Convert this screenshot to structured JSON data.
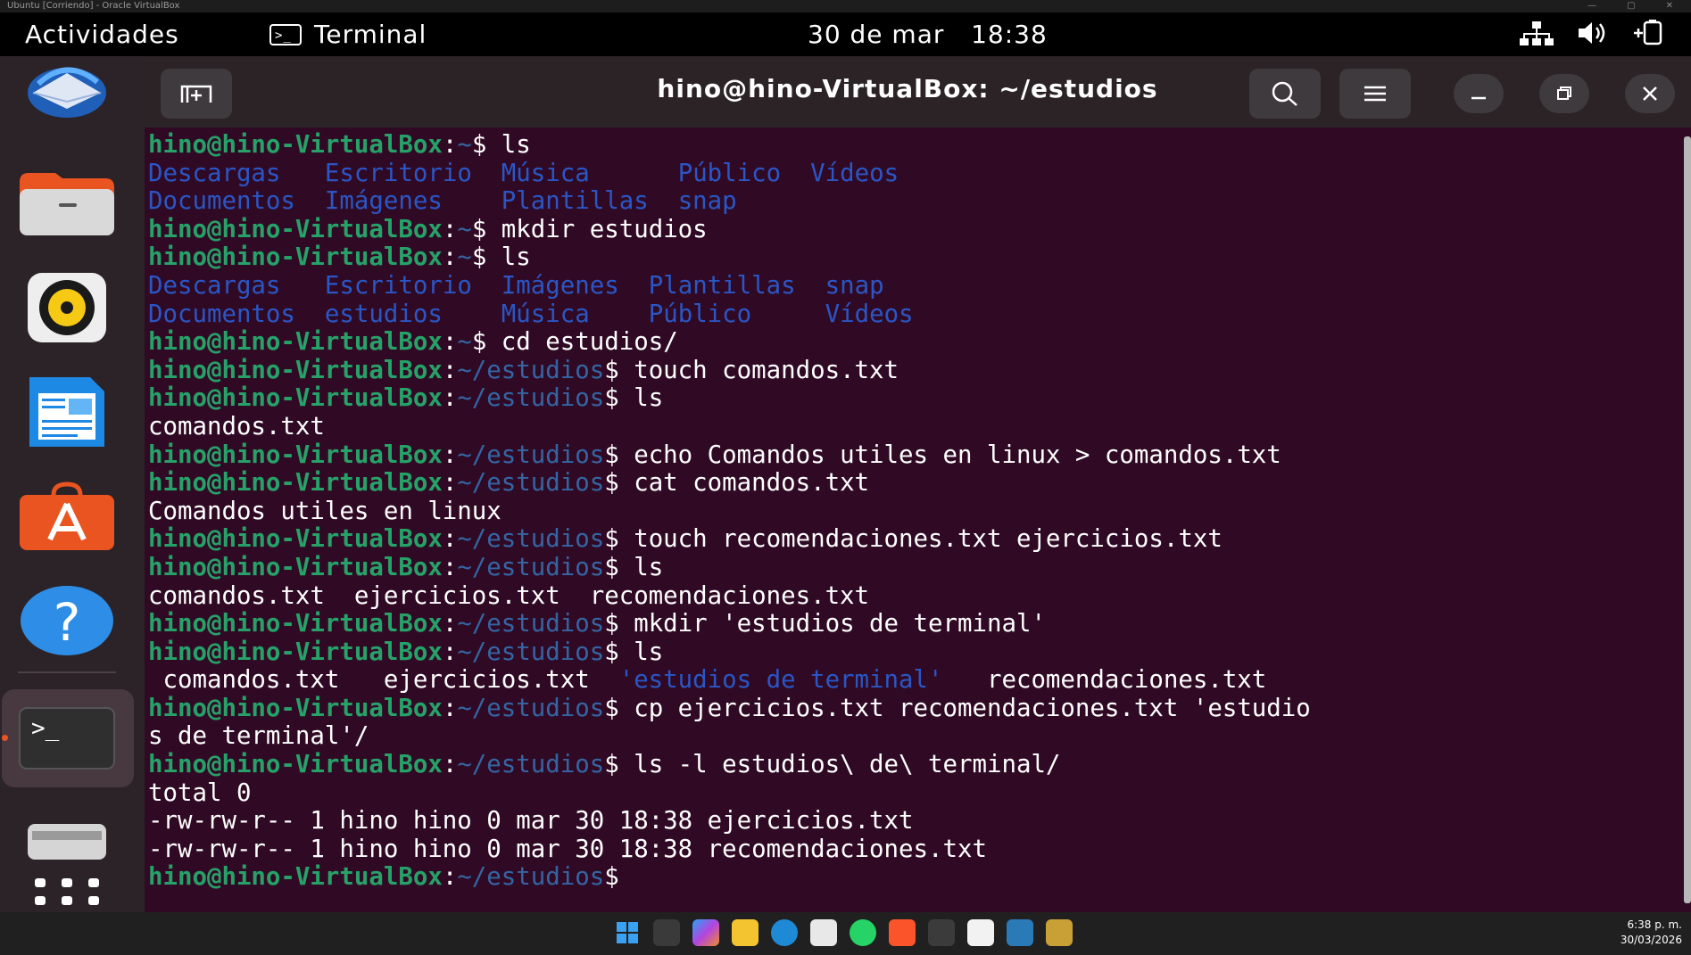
{
  "host": {
    "title": "Ubuntu [Corriendo] - Oracle VirtualBox",
    "controls": [
      "—",
      "▢",
      "✕"
    ]
  },
  "topbar": {
    "activities": "Actividades",
    "app_name": "Terminal",
    "term_glyph": ">_",
    "date": "30 de mar",
    "time": "18:38"
  },
  "window": {
    "title": "hino@hino-VirtualBox: ~/estudios"
  },
  "terminal": {
    "user": "hino@hino-VirtualBox",
    "lines": [
      [
        {
          "t": "hino@hino-VirtualBox",
          "c": "pu"
        },
        {
          "t": ":",
          "c": ""
        },
        {
          "t": "~",
          "c": "pp"
        },
        {
          "t": "$ ls",
          "c": ""
        }
      ],
      [
        {
          "t": "Descargas  ",
          "c": "dir"
        },
        {
          "t": " ",
          "c": ""
        },
        {
          "t": "Escritorio",
          "c": "dir"
        },
        {
          "t": "  ",
          "c": ""
        },
        {
          "t": "Música",
          "c": "dir"
        },
        {
          "t": "      ",
          "c": ""
        },
        {
          "t": "Público",
          "c": "dir"
        },
        {
          "t": "  ",
          "c": ""
        },
        {
          "t": "Vídeos",
          "c": "dir"
        }
      ],
      [
        {
          "t": "Documentos",
          "c": "dir"
        },
        {
          "t": "  ",
          "c": ""
        },
        {
          "t": "Imágenes",
          "c": "dir"
        },
        {
          "t": "    ",
          "c": ""
        },
        {
          "t": "Plantillas",
          "c": "dir"
        },
        {
          "t": "  ",
          "c": ""
        },
        {
          "t": "snap",
          "c": "dir"
        }
      ],
      [
        {
          "t": "hino@hino-VirtualBox",
          "c": "pu"
        },
        {
          "t": ":",
          "c": ""
        },
        {
          "t": "~",
          "c": "pp"
        },
        {
          "t": "$ mkdir estudios",
          "c": ""
        }
      ],
      [
        {
          "t": "hino@hino-VirtualBox",
          "c": "pu"
        },
        {
          "t": ":",
          "c": ""
        },
        {
          "t": "~",
          "c": "pp"
        },
        {
          "t": "$ ls",
          "c": ""
        }
      ],
      [
        {
          "t": "Descargas",
          "c": "dir"
        },
        {
          "t": "   ",
          "c": ""
        },
        {
          "t": "Escritorio",
          "c": "dir"
        },
        {
          "t": "  ",
          "c": ""
        },
        {
          "t": "Imágenes",
          "c": "dir"
        },
        {
          "t": "  ",
          "c": ""
        },
        {
          "t": "Plantillas",
          "c": "dir"
        },
        {
          "t": "  ",
          "c": ""
        },
        {
          "t": "snap",
          "c": "dir"
        }
      ],
      [
        {
          "t": "Documentos",
          "c": "dir"
        },
        {
          "t": "  ",
          "c": ""
        },
        {
          "t": "estudios",
          "c": "dir"
        },
        {
          "t": "    ",
          "c": ""
        },
        {
          "t": "Música",
          "c": "dir"
        },
        {
          "t": "    ",
          "c": ""
        },
        {
          "t": "Público",
          "c": "dir"
        },
        {
          "t": "     ",
          "c": ""
        },
        {
          "t": "Vídeos",
          "c": "dir"
        }
      ],
      [
        {
          "t": "hino@hino-VirtualBox",
          "c": "pu"
        },
        {
          "t": ":",
          "c": ""
        },
        {
          "t": "~",
          "c": "pp"
        },
        {
          "t": "$ cd estudios/",
          "c": ""
        }
      ],
      [
        {
          "t": "hino@hino-VirtualBox",
          "c": "pu"
        },
        {
          "t": ":",
          "c": ""
        },
        {
          "t": "~/estudios",
          "c": "pp"
        },
        {
          "t": "$ touch comandos.txt",
          "c": ""
        }
      ],
      [
        {
          "t": "hino@hino-VirtualBox",
          "c": "pu"
        },
        {
          "t": ":",
          "c": ""
        },
        {
          "t": "~/estudios",
          "c": "pp"
        },
        {
          "t": "$ ls",
          "c": ""
        }
      ],
      [
        {
          "t": "comandos.txt",
          "c": ""
        }
      ],
      [
        {
          "t": "hino@hino-VirtualBox",
          "c": "pu"
        },
        {
          "t": ":",
          "c": ""
        },
        {
          "t": "~/estudios",
          "c": "pp"
        },
        {
          "t": "$ echo Comandos utiles en linux > comandos.txt",
          "c": ""
        }
      ],
      [
        {
          "t": "hino@hino-VirtualBox",
          "c": "pu"
        },
        {
          "t": ":",
          "c": ""
        },
        {
          "t": "~/estudios",
          "c": "pp"
        },
        {
          "t": "$ cat comandos.txt",
          "c": ""
        }
      ],
      [
        {
          "t": "Comandos utiles en linux",
          "c": ""
        }
      ],
      [
        {
          "t": "hino@hino-VirtualBox",
          "c": "pu"
        },
        {
          "t": ":",
          "c": ""
        },
        {
          "t": "~/estudios",
          "c": "pp"
        },
        {
          "t": "$ touch recomendaciones.txt ejercicios.txt",
          "c": ""
        }
      ],
      [
        {
          "t": "hino@hino-VirtualBox",
          "c": "pu"
        },
        {
          "t": ":",
          "c": ""
        },
        {
          "t": "~/estudios",
          "c": "pp"
        },
        {
          "t": "$ ls",
          "c": ""
        }
      ],
      [
        {
          "t": "comandos.txt  ejercicios.txt  recomendaciones.txt",
          "c": ""
        }
      ],
      [
        {
          "t": "hino@hino-VirtualBox",
          "c": "pu"
        },
        {
          "t": ":",
          "c": ""
        },
        {
          "t": "~/estudios",
          "c": "pp"
        },
        {
          "t": "$ mkdir 'estudios de terminal'",
          "c": ""
        }
      ],
      [
        {
          "t": "hino@hino-VirtualBox",
          "c": "pu"
        },
        {
          "t": ":",
          "c": ""
        },
        {
          "t": "~/estudios",
          "c": "pp"
        },
        {
          "t": "$ ls",
          "c": ""
        }
      ],
      [
        {
          "t": " comandos.txt   ejercicios.txt  ",
          "c": ""
        },
        {
          "t": "'estudios de terminal'",
          "c": "dir"
        },
        {
          "t": "   recomendaciones.txt",
          "c": ""
        }
      ],
      [
        {
          "t": "hino@hino-VirtualBox",
          "c": "pu"
        },
        {
          "t": ":",
          "c": ""
        },
        {
          "t": "~/estudios",
          "c": "pp"
        },
        {
          "t": "$ cp ejercicios.txt recomendaciones.txt 'estudio",
          "c": ""
        }
      ],
      [
        {
          "t": "s de terminal'/",
          "c": ""
        }
      ],
      [
        {
          "t": "hino@hino-VirtualBox",
          "c": "pu"
        },
        {
          "t": ":",
          "c": ""
        },
        {
          "t": "~/estudios",
          "c": "pp"
        },
        {
          "t": "$ ls -l estudios\\ de\\ terminal/",
          "c": ""
        }
      ],
      [
        {
          "t": "total 0",
          "c": ""
        }
      ],
      [
        {
          "t": "-rw-rw-r-- 1 hino hino 0 mar 30 18:38 ejercicios.txt",
          "c": ""
        }
      ],
      [
        {
          "t": "-rw-rw-r-- 1 hino hino 0 mar 30 18:38 recomendaciones.txt",
          "c": ""
        }
      ],
      [
        {
          "t": "hino@hino-VirtualBox",
          "c": "pu"
        },
        {
          "t": ":",
          "c": ""
        },
        {
          "t": "~/estudios",
          "c": "pp"
        },
        {
          "t": "$ ",
          "c": ""
        }
      ]
    ]
  },
  "taskbar": {
    "time": "6:38 p. m.",
    "date": "30/03/2026"
  },
  "colors": {
    "terminal_bg": "#300a24",
    "prompt_user": "#26a269",
    "prompt_path": "#3465a4",
    "accent": "#e95420"
  }
}
